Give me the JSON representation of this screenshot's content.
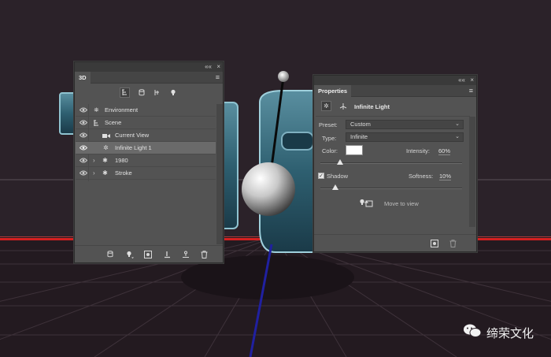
{
  "panel_3d": {
    "title": "3D",
    "collapse": "««",
    "close": "×",
    "filter_icons": [
      "scene-filter-icon",
      "mesh-filter-icon",
      "material-filter-icon",
      "light-filter-icon"
    ],
    "layers": [
      {
        "label": "Environment",
        "visible": true,
        "icon": "environment-icon"
      },
      {
        "label": "Scene",
        "visible": true,
        "icon": "scene-icon"
      },
      {
        "label": "Current View",
        "visible": true,
        "icon": "camera-icon"
      },
      {
        "label": "Infinite Light 1",
        "visible": true,
        "icon": "infinite-light-icon",
        "selected": true
      },
      {
        "label": "1980",
        "visible": true,
        "icon": "mesh-icon",
        "expandable": true
      },
      {
        "label": "Stroke",
        "visible": true,
        "icon": "mesh-icon",
        "expandable": true
      }
    ],
    "footer_icons": [
      "render-icon",
      "add-light-icon",
      "add-material-icon",
      "ground-icon",
      "constraint-icon",
      "trash-icon"
    ]
  },
  "panel_properties": {
    "title": "Properties",
    "collapse": "««",
    "close": "×",
    "heading": "Infinite Light",
    "preset_label": "Preset:",
    "preset_value": "Custom",
    "type_label": "Type:",
    "type_value": "Infinite",
    "color_label": "Color:",
    "color_value": "#ffffff",
    "intensity_label": "Intensity:",
    "intensity_value": "60%",
    "intensity_fraction": 0.6,
    "shadow_label": "Shadow",
    "shadow_checked": true,
    "softness_label": "Softness:",
    "softness_value": "10%",
    "softness_fraction": 0.1,
    "move_to_view": "Move to view"
  },
  "watermark": {
    "text": "缔荣文化"
  },
  "colors": {
    "panel": "#535353",
    "panel_dark": "#3a3a3a",
    "selection": "#6a6a6a",
    "background": "#2b2229",
    "grid_red": "#d42020"
  }
}
